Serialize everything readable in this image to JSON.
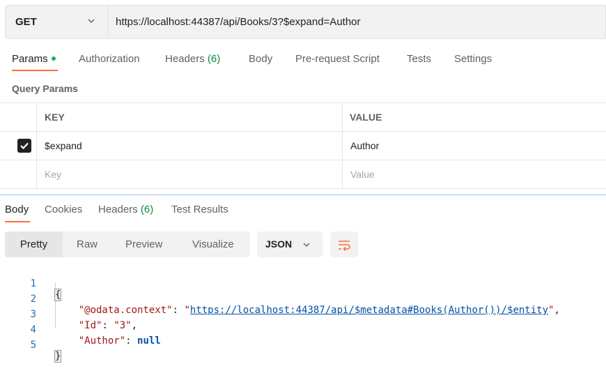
{
  "request": {
    "method": "GET",
    "url": "https://localhost:44387/api/Books/3?$expand=Author"
  },
  "request_tabs": [
    {
      "label": "Params",
      "active": true
    },
    {
      "label": "Authorization"
    },
    {
      "label": "Headers",
      "count": "(6)"
    },
    {
      "label": "Body"
    },
    {
      "label": "Pre-request Script"
    },
    {
      "label": "Tests"
    },
    {
      "label": "Settings"
    }
  ],
  "query_params": {
    "title": "Query Params",
    "headers": {
      "key": "KEY",
      "value": "VALUE"
    },
    "rows": [
      {
        "checked": true,
        "key": "$expand",
        "value": "Author"
      }
    ],
    "placeholder": {
      "key": "Key",
      "value": "Value"
    }
  },
  "response_tabs": [
    {
      "label": "Body",
      "active": true
    },
    {
      "label": "Cookies"
    },
    {
      "label": "Headers",
      "count": "(6)"
    },
    {
      "label": "Test Results"
    }
  ],
  "view_modes": [
    "Pretty",
    "Raw",
    "Preview",
    "Visualize"
  ],
  "selected_view": "Pretty",
  "format": "JSON",
  "code": {
    "line_numbers": [
      "1",
      "2",
      "3",
      "4",
      "5"
    ],
    "open_brace": "{",
    "close_brace": "}",
    "l2_key": "\"@odata.context\"",
    "l2_colon": ": ",
    "l2_value": "\"https://localhost:44387/api/$metadata#Books(Author())/$entity\"",
    "l2_comma": ",",
    "l3_key": "\"Id\"",
    "l3_colon": ": ",
    "l3_value": "\"3\"",
    "l3_comma": ",",
    "l4_key": "\"Author\"",
    "l4_colon": ": ",
    "l4_value": "null"
  },
  "colors": {
    "accent": "#ff6c37",
    "params_dot": "#0cbb52",
    "count": "#0b8a3e"
  }
}
